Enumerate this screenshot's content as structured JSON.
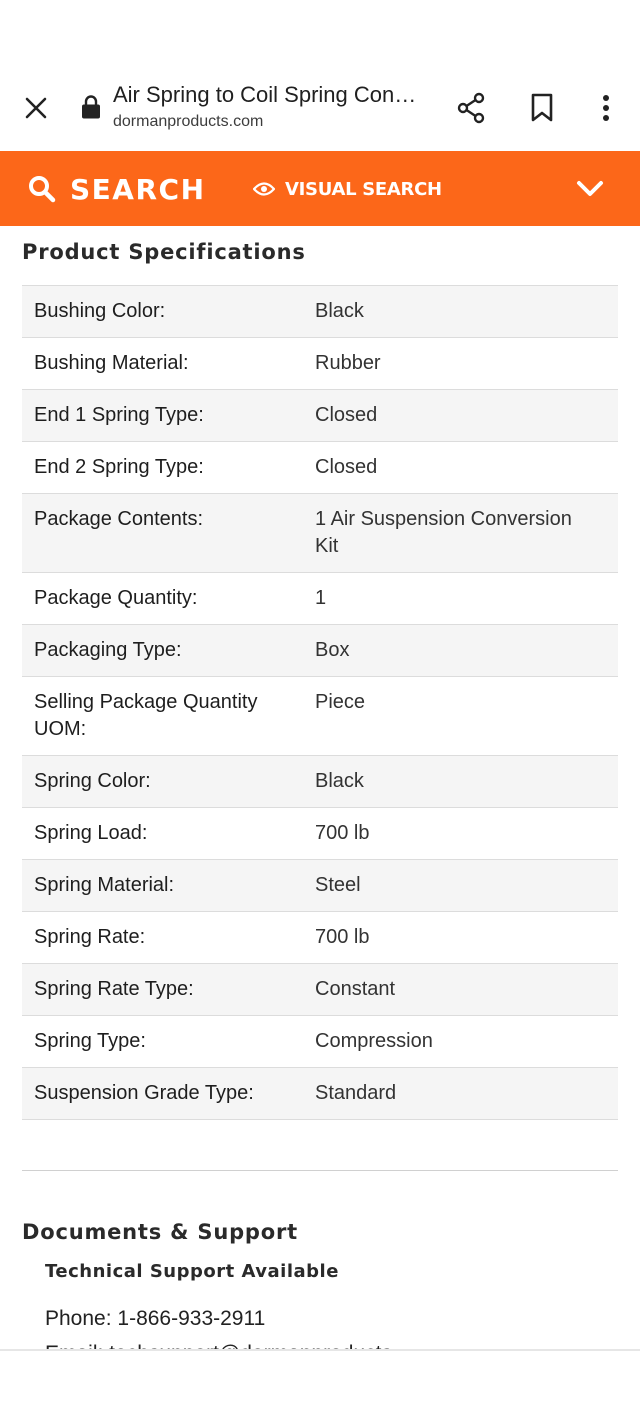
{
  "browser": {
    "page_title": "Air Spring to Coil Spring Con…",
    "domain": "dormanproducts.com",
    "icons": [
      "close-icon",
      "lock-icon",
      "share-icon",
      "bookmark-icon",
      "more-vert-icon"
    ]
  },
  "search_bar": {
    "search_label": "SEARCH",
    "visual_search_label": "VISUAL SEARCH",
    "accent_color": "#fc6719"
  },
  "specs": {
    "title": "Product Specifications",
    "rows": [
      {
        "label": "Bushing Color:",
        "value": "Black"
      },
      {
        "label": "Bushing Material:",
        "value": "Rubber"
      },
      {
        "label": "End 1 Spring Type:",
        "value": "Closed"
      },
      {
        "label": "End 2 Spring Type:",
        "value": "Closed"
      },
      {
        "label": "Package Contents:",
        "value": "1 Air Suspension Conversion Kit"
      },
      {
        "label": "Package Quantity:",
        "value": "1"
      },
      {
        "label": "Packaging Type:",
        "value": "Box"
      },
      {
        "label": "Selling Package Quantity UOM:",
        "value": "Piece"
      },
      {
        "label": "Spring Color:",
        "value": "Black"
      },
      {
        "label": "Spring Load:",
        "value": "700 lb"
      },
      {
        "label": "Spring Material:",
        "value": "Steel"
      },
      {
        "label": "Spring Rate:",
        "value": "700 lb"
      },
      {
        "label": "Spring Rate Type:",
        "value": "Constant"
      },
      {
        "label": "Spring Type:",
        "value": "Compression"
      },
      {
        "label": "Suspension Grade Type:",
        "value": "Standard"
      }
    ]
  },
  "documents": {
    "title": "Documents & Support",
    "support_title": "Technical Support Available",
    "phone": "Phone: 1-866-933-2911",
    "email_partial": "Email: techsupport@dormanproducts..."
  }
}
